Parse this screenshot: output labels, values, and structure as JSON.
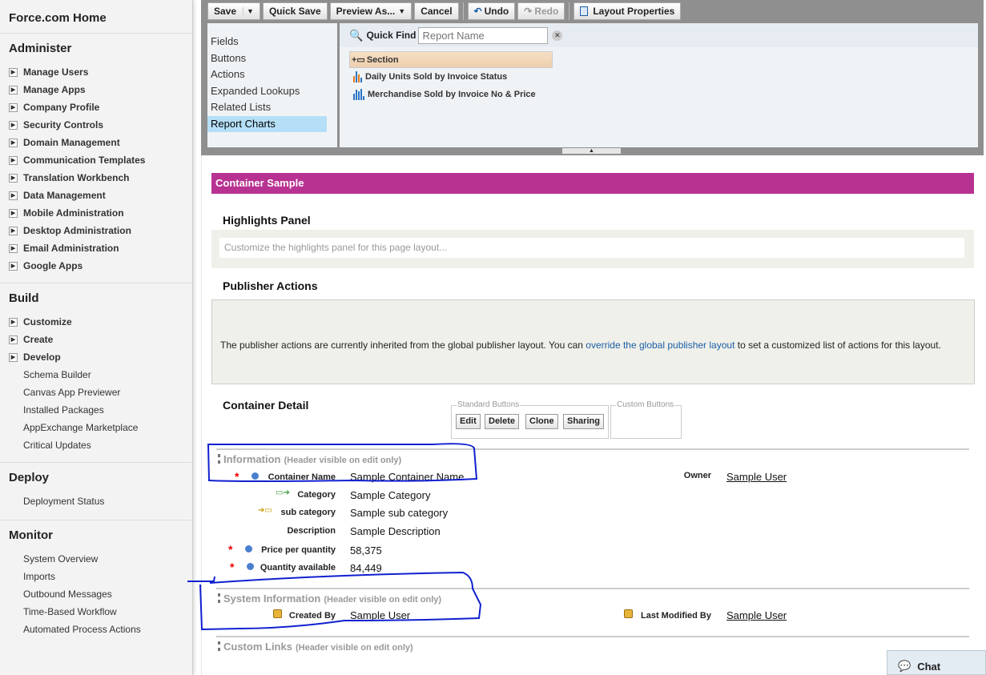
{
  "sidebar": {
    "home": "Force.com Home",
    "administer": {
      "title": "Administer",
      "items": [
        "Manage Users",
        "Manage Apps",
        "Company Profile",
        "Security Controls",
        "Domain Management",
        "Communication Templates",
        "Translation Workbench",
        "Data Management",
        "Mobile Administration",
        "Desktop Administration",
        "Email Administration",
        "Google Apps"
      ]
    },
    "build": {
      "title": "Build",
      "items": [
        "Customize",
        "Create",
        "Develop"
      ],
      "subitems": [
        "Schema Builder",
        "Canvas App Previewer",
        "Installed Packages",
        "AppExchange Marketplace",
        "Critical Updates"
      ]
    },
    "deploy": {
      "title": "Deploy",
      "subitems": [
        "Deployment Status"
      ]
    },
    "monitor": {
      "title": "Monitor",
      "subitems": [
        "System Overview",
        "Imports",
        "Outbound Messages",
        "Time-Based Workflow",
        "Automated Process Actions"
      ]
    }
  },
  "toolbar": {
    "save": "Save",
    "quick_save": "Quick Save",
    "preview_as": "Preview As...",
    "cancel": "Cancel",
    "undo": "Undo",
    "redo": "Redo",
    "layout_properties": "Layout Properties"
  },
  "palette": {
    "categories": [
      "Fields",
      "Buttons",
      "Actions",
      "Expanded Lookups",
      "Related Lists",
      "Report Charts"
    ],
    "selected": "Report Charts",
    "quick_find_label": "Quick Find",
    "quick_find_placeholder": "Report Name",
    "items": [
      "Section",
      "Daily Units Sold by Invoice Status",
      "Merchandise Sold by Invoice No & Price"
    ]
  },
  "layout": {
    "banner": "Container Sample",
    "highlights_title": "Highlights Panel",
    "highlights_placeholder": "Customize the highlights panel for this page layout...",
    "publisher_title": "Publisher Actions",
    "publisher_text_1": "The publisher actions are currently inherited from the global publisher layout. You can ",
    "publisher_link": "override the global publisher layout",
    "publisher_text_2": " to set a customized list of actions for this layout.",
    "detail_title": "Container Detail",
    "standard_buttons_legend": "Standard Buttons",
    "standard_buttons": [
      "Edit",
      "Delete",
      "Clone",
      "Sharing"
    ],
    "custom_buttons_legend": "Custom Buttons",
    "sections": [
      {
        "title": "Information",
        "note": "(Header visible on edit only)",
        "fields": [
          {
            "label": "Container Name",
            "value": "Sample Container Name"
          },
          {
            "label": "Category",
            "value": "Sample Category"
          },
          {
            "label": "sub category",
            "value": "Sample sub category"
          },
          {
            "label": "Description",
            "value": "Sample Description"
          },
          {
            "label": "Price per quantity",
            "value": "58,375"
          },
          {
            "label": "Quantity available",
            "value": "84,449"
          },
          {
            "label": "Owner",
            "value": "Sample User"
          }
        ]
      },
      {
        "title": "System Information",
        "note": "(Header visible on edit only)",
        "fields": [
          {
            "label": "Created By",
            "value": "Sample User"
          },
          {
            "label": "Last Modified By",
            "value": "Sample User"
          }
        ]
      },
      {
        "title": "Custom Links",
        "note": "(Header visible on edit only)"
      }
    ]
  },
  "chat": {
    "label": "Chat"
  },
  "colors": {
    "banner": "#b83292",
    "annotation": "#1020d0"
  }
}
